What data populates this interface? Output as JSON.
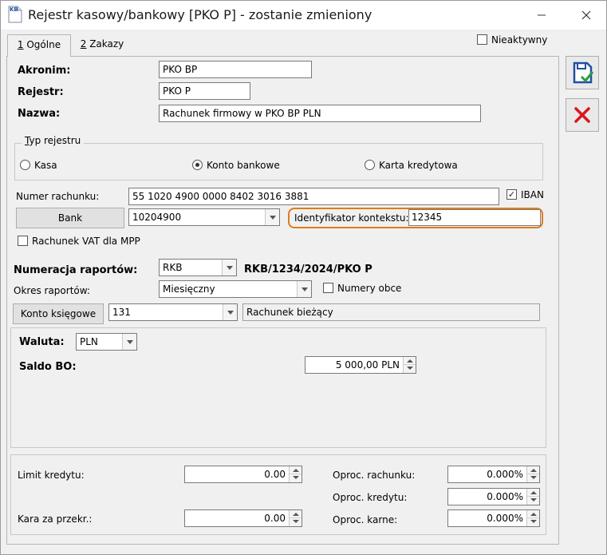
{
  "window": {
    "title": "Rejestr kasowy/bankowy [PKO P] - zostanie zmieniony",
    "app_icon_text": "KB"
  },
  "tabs": [
    {
      "label": "1 Ogólne",
      "hotkey": "1",
      "rest": " Ogólne",
      "active": true
    },
    {
      "label": "2 Zakazy",
      "hotkey": "2",
      "rest": " Zakazy",
      "active": false
    }
  ],
  "nieaktywny": {
    "label": "Nieaktywny",
    "checked": false
  },
  "fields": {
    "akronim": {
      "label": "Akronim:",
      "value": "PKO BP"
    },
    "rejestr": {
      "label": "Rejestr:",
      "value": "PKO P"
    },
    "nazwa": {
      "label": "Nazwa:",
      "value": "Rachunek firmowy w PKO BP PLN"
    }
  },
  "typ_rejestru": {
    "title": "Typ rejestru",
    "title_hotkey": "T",
    "title_rest": "yp rejestru",
    "options": [
      {
        "label": "Kasa",
        "selected": false
      },
      {
        "label": "Konto bankowe",
        "selected": true
      },
      {
        "label": "Karta kredytowa",
        "selected": false
      }
    ]
  },
  "rachunek": {
    "label": "Numer rachunku:",
    "value": "55 1020 4900 0000 8402 3016 3881",
    "iban": {
      "label": "IBAN",
      "checked": true
    }
  },
  "bank": {
    "button_label": "Bank",
    "code": "10204900",
    "identyfikator_label": "Identyfikator kontekstu:",
    "identyfikator_value": "12345"
  },
  "vat_mpp": {
    "label": "Rachunek VAT dla MPP",
    "checked": false
  },
  "numeracja": {
    "label": "Numeracja raportów:",
    "value": "RKB",
    "preview": "RKB/1234/2024/PKO P"
  },
  "okres": {
    "label": "Okres raportów:",
    "value": "Miesięczny",
    "numery_obce": {
      "label": "Numery obce",
      "checked": false
    }
  },
  "konto": {
    "button_label": "Konto księgowe",
    "value": "131",
    "description": "Rachunek bieżący"
  },
  "waluta": {
    "label": "Waluta:",
    "value": "PLN"
  },
  "saldo": {
    "label": "Saldo BO:",
    "value": "5 000,00 PLN"
  },
  "limits": {
    "limit_kredytu": {
      "label": "Limit kredytu:",
      "value": "0.00"
    },
    "kara": {
      "label": "Kara za przekr.:",
      "value": "0.00"
    },
    "oproc_rachunku": {
      "label": "Oproc. rachunku:",
      "value": "0.000%"
    },
    "oproc_kredytu": {
      "label": "Oproc. kredytu:",
      "value": "0.000%"
    },
    "oproc_karne": {
      "label": "Oproc. karne:",
      "value": "0.000%"
    }
  },
  "side_buttons": [
    {
      "name": "save-icon",
      "color": "#1f4fa3"
    },
    {
      "name": "cancel-icon",
      "color": "#d9161c"
    }
  ]
}
